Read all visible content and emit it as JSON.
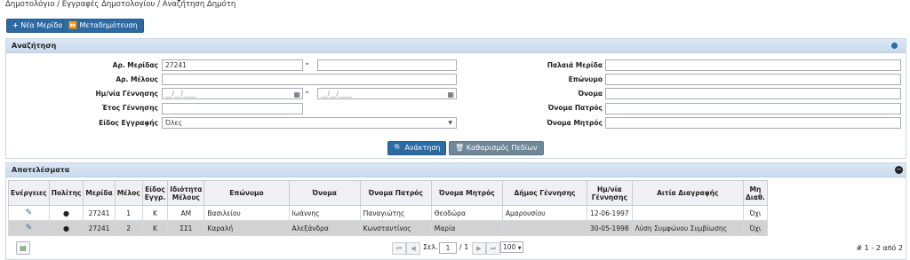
{
  "breadcrumb": [
    "Δημοτολόγιο",
    "Εγγραφές Δημοτολογίου",
    "Αναζήτηση Δημότη"
  ],
  "breadcrumb_sep": "/",
  "toolbar": {
    "new_label": "Νέα Μερίδα",
    "transfer_label": "Μεταδημότευση"
  },
  "search": {
    "title": "Αναζήτηση",
    "labels": {
      "ar_meridas": "Αρ. Μερίδας",
      "ar_melous": "Αρ. Μέλους",
      "birth_date": "Ημ/νία Γέννησης",
      "birth_year": "Έτος Γέννησης",
      "reg_type": "Είδος Εγγραφής",
      "old_merida": "Παλαιά Μερίδα",
      "surname": "Επώνυμο",
      "name": "Όνομα",
      "father": "Όνομα Πατρός",
      "mother": "Όνομα Μητρός"
    },
    "values": {
      "ar_meridas": "27241",
      "reg_type": "Όλες"
    },
    "date_placeholder": "__/__/____",
    "range_sep": "-",
    "search_button": "Ανάκτηση",
    "clear_button": "Καθαρισμός Πεδίων"
  },
  "results": {
    "title": "Αποτελέσματα",
    "columns": [
      "Ενέργειες",
      "Πολίτης",
      "Μερίδα",
      "Μέλος",
      "Είδος Εγγρ.",
      "Ιδιότητα Μέλους",
      "Επώνυμο",
      "Όνομα",
      "Όνομα Πατρός",
      "Όνομα Μητρός",
      "Δήμος Γέννησης",
      "Ημ/νία Γέννησης",
      "Αιτία Διαγραφής",
      "Μη Διαθ."
    ],
    "rows": [
      {
        "merida": "27241",
        "melos": "1",
        "eidos": "Κ",
        "idiotita": "ΑΜ",
        "eponymo": "Βασιλείου",
        "onoma": "Ιωάννης",
        "pateras": "Παναγιώτης",
        "mitera": "Θεοδώρα",
        "dimos": "Αμαρουσίου",
        "birth": "12-06-1997",
        "aitia": "",
        "mi_diath": "Όχι"
      },
      {
        "merida": "27241",
        "melos": "2",
        "eidos": "Κ",
        "idiotita": "ΣΣ1",
        "eponymo": "Καραλή",
        "onoma": "Αλεξάνδρα",
        "pateras": "Κωνσταντίνος",
        "mitera": "Μαρία",
        "dimos": "",
        "birth": "30-05-1998",
        "aitia": "Λύση Συμφώνου Συμβίωσης",
        "mi_diath": "Όχι"
      }
    ],
    "pager": {
      "page_label": "Σελ.",
      "page": "1",
      "of": "/ 1",
      "page_size": "100",
      "count": "# 1 - 2 από 2"
    }
  },
  "colors": {
    "primary": "#2b6aa3",
    "header_bg": "#c9dbee",
    "alt_row": "#d2d2d2",
    "indicator": "#2b6aa3"
  }
}
